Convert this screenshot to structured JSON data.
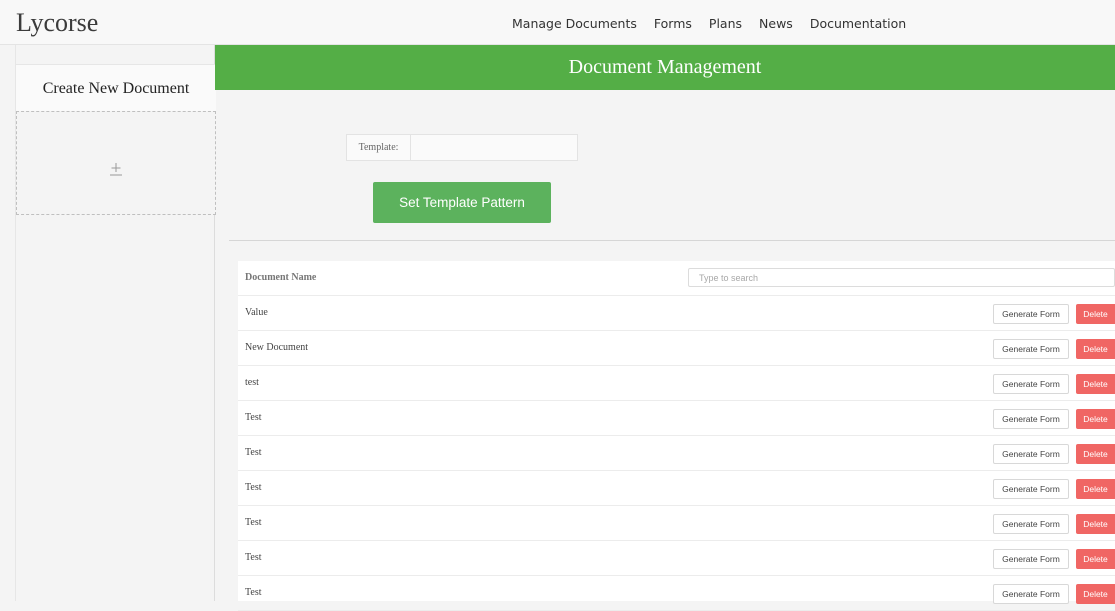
{
  "brand": "Lycorse",
  "nav": [
    "Manage Documents",
    "Forms",
    "Plans",
    "News",
    "Documentation"
  ],
  "sidebar": {
    "create_title": "Create New Document",
    "add_icon": "plus-icon"
  },
  "main": {
    "banner_title": "Document Management",
    "template_label": "Template:",
    "template_value": "",
    "set_button": "Set Template Pattern"
  },
  "table": {
    "header_label": "Document Name",
    "search_placeholder": "Type to search",
    "generate_label": "Generate Form",
    "delete_label": "Delete",
    "rows": [
      "Value",
      "New Document",
      "test",
      "Test",
      "Test",
      "Test",
      "Test",
      "Test",
      "Test"
    ]
  },
  "colors": {
    "banner": "#54ae46",
    "primary_button": "#5cb25d",
    "delete_button": "#f06664"
  }
}
